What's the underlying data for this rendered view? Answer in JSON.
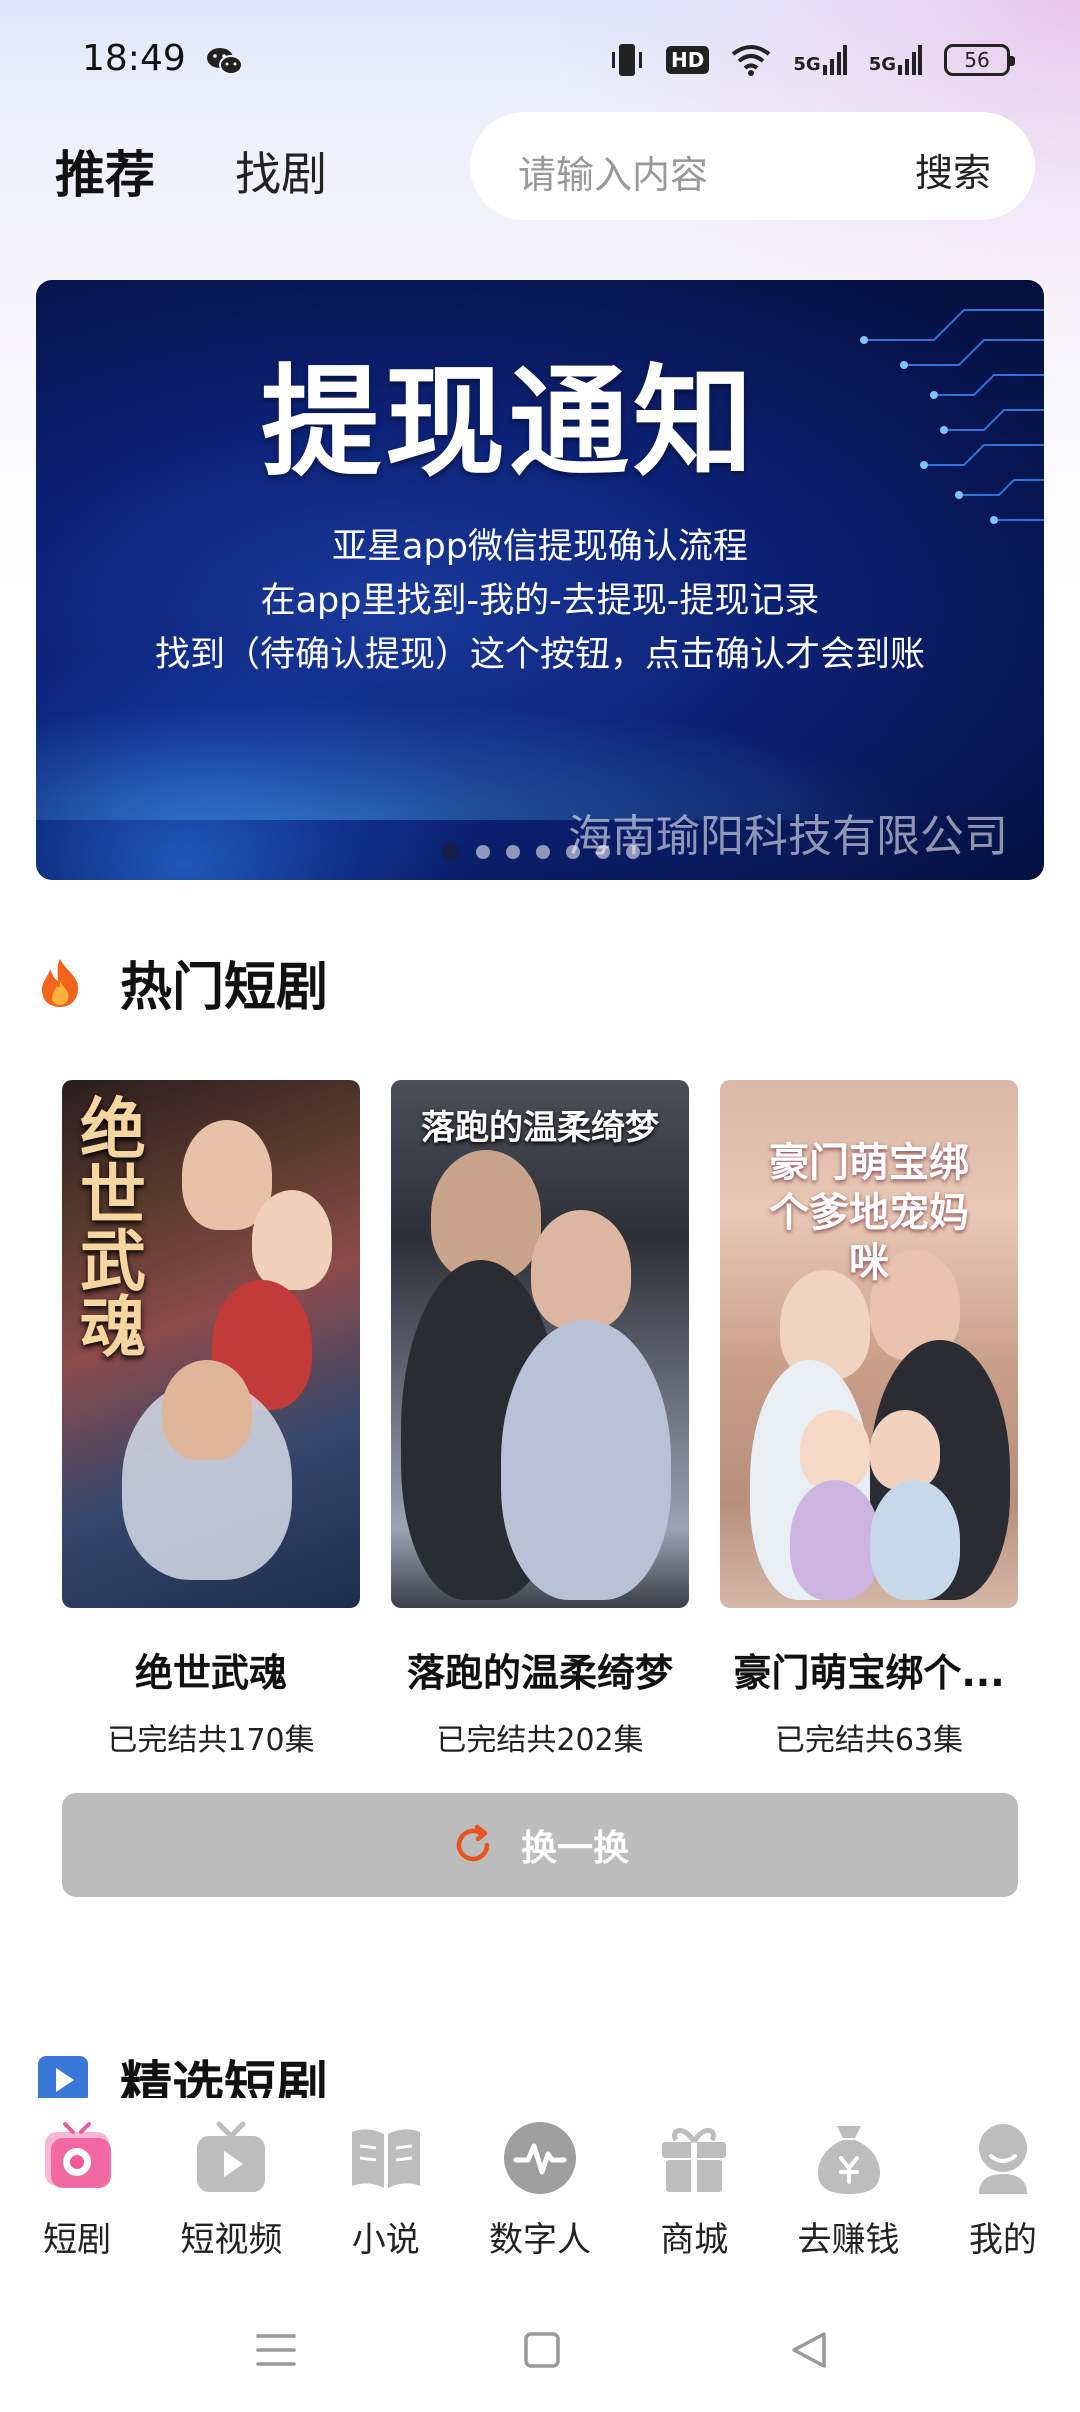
{
  "status_bar": {
    "time": "18:49",
    "battery": "56",
    "hd_badge": "HD",
    "signal_1": "5G",
    "signal_2": "5G"
  },
  "header": {
    "tab_recommend": "推荐",
    "tab_find": "找剧",
    "search_placeholder": "请输入内容",
    "search_button": "搜索"
  },
  "banner": {
    "title": "提现通知",
    "lines": [
      "亚星app微信提现确认流程",
      "在app里找到-我的-去提现-提现记录",
      "找到（待确认提现）这个按钮，点击确认才会到账"
    ],
    "company": "海南瑜阳科技有限公司",
    "slide_count": 7,
    "active_slide": 1
  },
  "hot_section": {
    "title": "热门短剧",
    "cards": [
      {
        "name": "绝世武魂",
        "meta": "已完结共170集",
        "poster_text": "绝世武魂"
      },
      {
        "name": "落跑的温柔绮梦",
        "meta": "已完结共202集",
        "poster_text": "落跑的温柔绮梦"
      },
      {
        "name": "豪门萌宝绑个...",
        "meta": "已完结共63集",
        "poster_text": "豪门萌宝绑个爹地宠妈咪"
      }
    ],
    "refresh_label": "换一换"
  },
  "selected_section": {
    "title": "精选短剧"
  },
  "bottom_nav": {
    "items": [
      {
        "label": "短剧",
        "icon": "drama-icon"
      },
      {
        "label": "短视频",
        "icon": "tv-play-icon"
      },
      {
        "label": "小说",
        "icon": "book-icon"
      },
      {
        "label": "数字人",
        "icon": "pulse-icon"
      },
      {
        "label": "商城",
        "icon": "gift-icon"
      },
      {
        "label": "去赚钱",
        "icon": "money-bag-icon"
      },
      {
        "label": "我的",
        "icon": "profile-icon"
      }
    ],
    "active_index": 0
  },
  "colors": {
    "banner_bg": "#0c2277",
    "refresh_bg": "#bcbcbc",
    "refresh_icon": "#e8541e",
    "active_tab": "#f05a9a",
    "inactive_icon": "#bdbdbd"
  }
}
